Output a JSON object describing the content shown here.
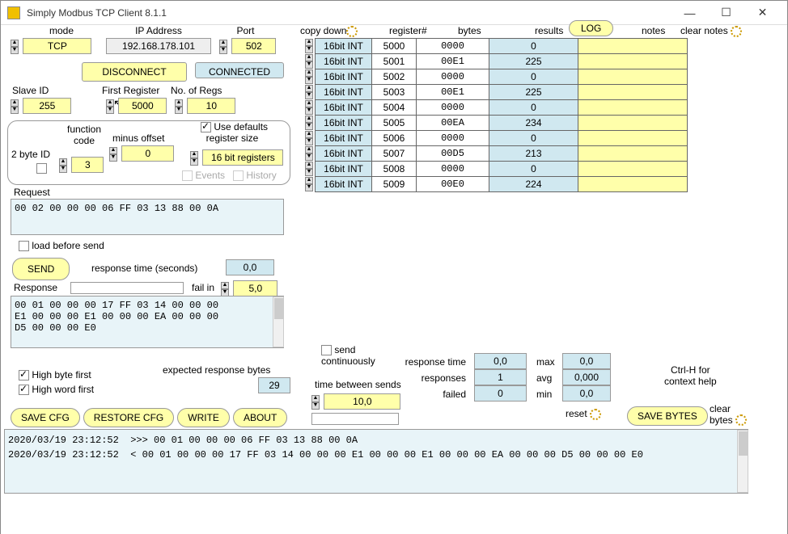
{
  "window_title": "Simply Modbus TCP Client 8.1.1",
  "labels": {
    "mode": "mode",
    "ip": "IP Address",
    "port": "Port",
    "slave_id": "Slave ID",
    "first_reg": "First Register",
    "no_regs": "No. of Regs",
    "two_byte": "2 byte ID",
    "func_code": "function\ncode",
    "minus_offset": "minus offset",
    "use_defaults": "Use defaults\n  register size",
    "request": "Request",
    "load_before": "load before send",
    "resp_time_s": "response time (seconds)",
    "response": "Response",
    "fail_in": "fail in",
    "high_byte": "High byte first",
    "high_word": "High word first",
    "expected_bytes": "expected response bytes",
    "events": "Events",
    "history": "History",
    "copy_down": "copy down",
    "register_num": "register#",
    "bytes": "bytes",
    "results": "results",
    "notes": "notes",
    "clear_notes": "clear notes",
    "send_cont": "send\ncontinuously",
    "time_between": "time between sends",
    "resp_time": "response time",
    "responses": "responses",
    "failed": "failed",
    "max": "max",
    "avg": "avg",
    "min": "min",
    "reset": "reset",
    "ctrl_h": "Ctrl-H for\ncontext help",
    "clear_bytes": "clear\nbytes"
  },
  "fields": {
    "mode": "TCP",
    "ip": "192.168.178.101",
    "port": "502",
    "slave_id": "255",
    "first_reg": "5000",
    "no_regs": "10",
    "func_code": "3",
    "minus_offset": "0",
    "reg_size": "16 bit registers",
    "request_hex": "00 02 00 00 00 06 FF 03 13 88 00 0A",
    "resp_time_val": "0,0",
    "fail_in_val": "5,0",
    "response_hex": "00 01 00 00 00 17 FF 03 14 00 00 00\nE1 00 00 00 E1 00 00 00 EA 00 00 00\nD5 00 00 00 E0",
    "expected_bytes_val": "29",
    "time_between_val": "10,0",
    "rt_resp_time": "0,0",
    "rt_responses": "1",
    "rt_failed": "0",
    "rt_max": "0,0",
    "rt_avg": "0,000",
    "rt_min": "0,0"
  },
  "buttons": {
    "disconnect": "DISCONNECT",
    "connected": "CONNECTED",
    "send": "SEND",
    "save_cfg": "SAVE CFG",
    "restore_cfg": "RESTORE CFG",
    "write": "WRITE",
    "about": "ABOUT",
    "log": "LOG",
    "save_bytes": "SAVE BYTES"
  },
  "chk": {
    "two_byte": false,
    "use_defaults": true,
    "events": false,
    "history": false,
    "load_before": false,
    "high_byte": true,
    "high_word": true,
    "send_cont": false
  },
  "rows": [
    {
      "type": "16bit INT",
      "reg": "5000",
      "bytes": "0000",
      "result": "0",
      "notes": ""
    },
    {
      "type": "16bit INT",
      "reg": "5001",
      "bytes": "00E1",
      "result": "225",
      "notes": ""
    },
    {
      "type": "16bit INT",
      "reg": "5002",
      "bytes": "0000",
      "result": "0",
      "notes": ""
    },
    {
      "type": "16bit INT",
      "reg": "5003",
      "bytes": "00E1",
      "result": "225",
      "notes": ""
    },
    {
      "type": "16bit INT",
      "reg": "5004",
      "bytes": "0000",
      "result": "0",
      "notes": ""
    },
    {
      "type": "16bit INT",
      "reg": "5005",
      "bytes": "00EA",
      "result": "234",
      "notes": ""
    },
    {
      "type": "16bit INT",
      "reg": "5006",
      "bytes": "0000",
      "result": "0",
      "notes": ""
    },
    {
      "type": "16bit INT",
      "reg": "5007",
      "bytes": "00D5",
      "result": "213",
      "notes": ""
    },
    {
      "type": "16bit INT",
      "reg": "5008",
      "bytes": "0000",
      "result": "0",
      "notes": ""
    },
    {
      "type": "16bit INT",
      "reg": "5009",
      "bytes": "00E0",
      "result": "224",
      "notes": ""
    }
  ],
  "log_text": "2020/03/19 23:12:52  >>> 00 01 00 00 00 06 FF 03 13 88 00 0A\n2020/03/19 23:12:52  < 00 01 00 00 00 17 FF 03 14 00 00 00 E1 00 00 00 E1 00 00 00 EA 00 00 00 D5 00 00 00 E0"
}
